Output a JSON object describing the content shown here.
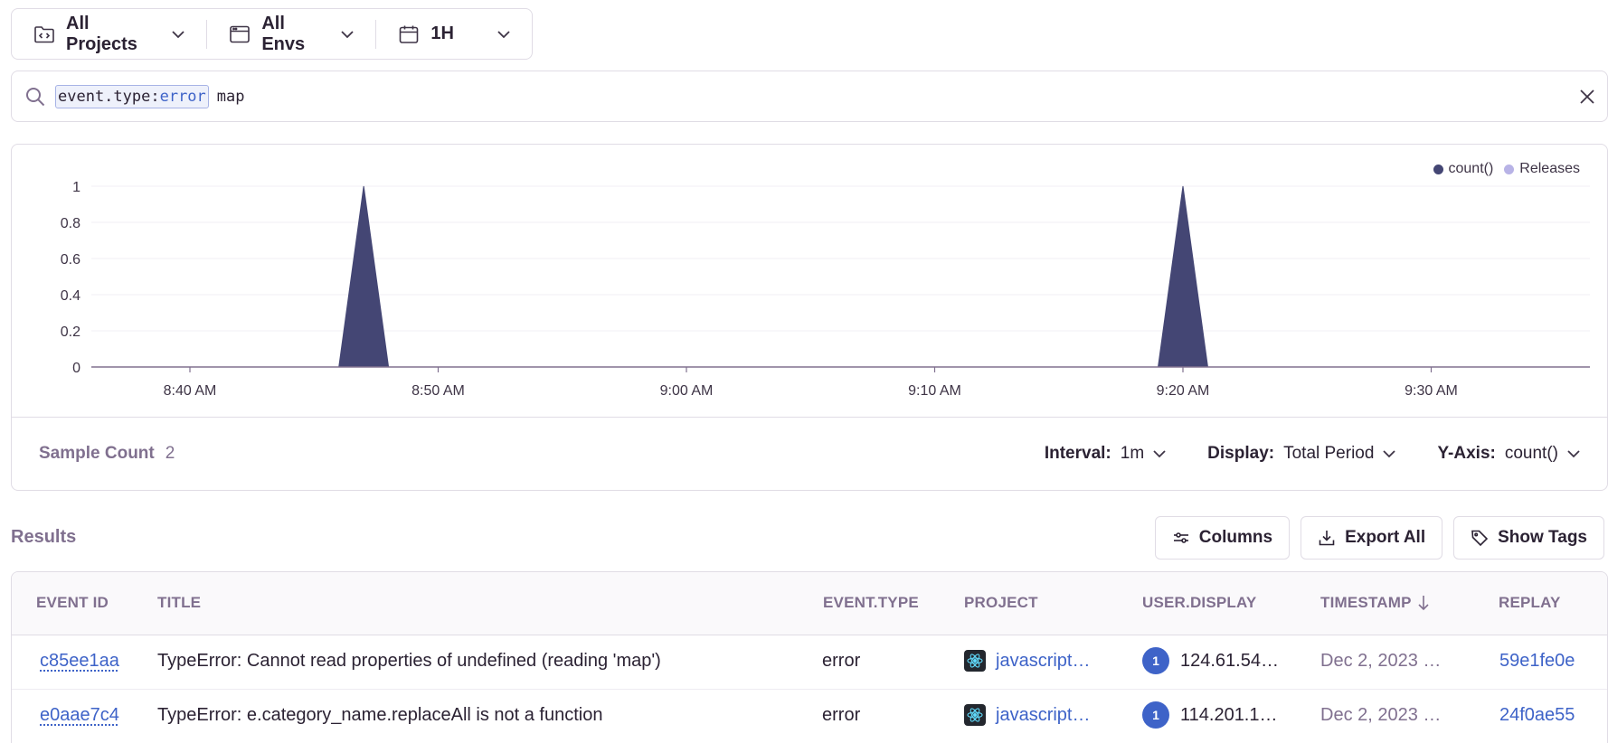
{
  "topbar": {
    "projects_label": "All Projects",
    "envs_label": "All Envs",
    "period_label": "1H"
  },
  "search": {
    "token_key": "event.type:",
    "token_value": "error",
    "free_text": "map"
  },
  "chart_data": {
    "type": "area",
    "x": [
      "8:40 AM",
      "8:50 AM",
      "9:00 AM",
      "9:10 AM",
      "9:20 AM",
      "9:30 AM"
    ],
    "series": [
      {
        "name": "count()",
        "color": "#444674",
        "points": [
          {
            "t": "8:46 AM",
            "v": 0
          },
          {
            "t": "8:47 AM",
            "v": 1
          },
          {
            "t": "8:48 AM",
            "v": 0
          },
          {
            "t": "9:19 AM",
            "v": 0
          },
          {
            "t": "9:20 AM",
            "v": 1
          },
          {
            "t": "9:21 AM",
            "v": 0
          }
        ]
      }
    ],
    "y_ticks": [
      "0",
      "0.2",
      "0.4",
      "0.6",
      "0.8",
      "1"
    ],
    "ylim": [
      0,
      1
    ],
    "legend": [
      {
        "label": "count()",
        "color": "#444674"
      },
      {
        "label": "Releases",
        "color": "#b8b3e6"
      }
    ],
    "grid": true,
    "legend_position": "top-right"
  },
  "chart_footer": {
    "sample_label": "Sample Count",
    "sample_value": "2",
    "interval_label": "Interval:",
    "interval_value": "1m",
    "display_label": "Display:",
    "display_value": "Total Period",
    "yaxis_label": "Y-Axis:",
    "yaxis_value": "count()"
  },
  "results": {
    "title": "Results",
    "columns_button": "Columns",
    "export_button": "Export All",
    "tags_button": "Show Tags"
  },
  "table": {
    "headers": {
      "event_id": "EVENT ID",
      "title": "TITLE",
      "event_type": "EVENT.TYPE",
      "project": "PROJECT",
      "user_display": "USER.DISPLAY",
      "timestamp": "TIMESTAMP",
      "replay": "REPLAY"
    },
    "rows": [
      {
        "event_id": "c85ee1aa",
        "title": "TypeError: Cannot read properties of undefined (reading 'map')",
        "event_type": "error",
        "project": "javascript…",
        "avatar": "1",
        "user_display": "124.61.54…",
        "timestamp": "Dec 2, 2023 …",
        "replay": "59e1fe0e"
      },
      {
        "event_id": "e0aae7c4",
        "title": "TypeError: e.category_name.replaceAll is not a function",
        "event_type": "error",
        "project": "javascript…",
        "avatar": "1",
        "user_display": "114.201.1…",
        "timestamp": "Dec 2, 2023 …",
        "replay": "24f0ae55"
      }
    ]
  }
}
